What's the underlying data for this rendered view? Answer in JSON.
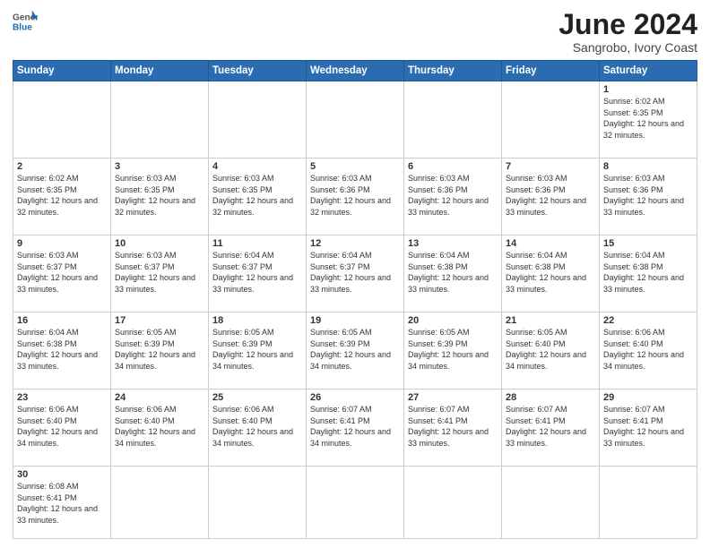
{
  "header": {
    "logo_general": "General",
    "logo_blue": "Blue",
    "month_title": "June 2024",
    "location": "Sangrobo, Ivory Coast"
  },
  "weekdays": [
    "Sunday",
    "Monday",
    "Tuesday",
    "Wednesday",
    "Thursday",
    "Friday",
    "Saturday"
  ],
  "weeks": [
    [
      {
        "day": "",
        "info": ""
      },
      {
        "day": "",
        "info": ""
      },
      {
        "day": "",
        "info": ""
      },
      {
        "day": "",
        "info": ""
      },
      {
        "day": "",
        "info": ""
      },
      {
        "day": "",
        "info": ""
      },
      {
        "day": "1",
        "info": "Sunrise: 6:02 AM\nSunset: 6:35 PM\nDaylight: 12 hours\nand 32 minutes."
      }
    ],
    [
      {
        "day": "2",
        "info": "Sunrise: 6:02 AM\nSunset: 6:35 PM\nDaylight: 12 hours\nand 32 minutes."
      },
      {
        "day": "3",
        "info": "Sunrise: 6:03 AM\nSunset: 6:35 PM\nDaylight: 12 hours\nand 32 minutes."
      },
      {
        "day": "4",
        "info": "Sunrise: 6:03 AM\nSunset: 6:35 PM\nDaylight: 12 hours\nand 32 minutes."
      },
      {
        "day": "5",
        "info": "Sunrise: 6:03 AM\nSunset: 6:36 PM\nDaylight: 12 hours\nand 32 minutes."
      },
      {
        "day": "6",
        "info": "Sunrise: 6:03 AM\nSunset: 6:36 PM\nDaylight: 12 hours\nand 33 minutes."
      },
      {
        "day": "7",
        "info": "Sunrise: 6:03 AM\nSunset: 6:36 PM\nDaylight: 12 hours\nand 33 minutes."
      },
      {
        "day": "8",
        "info": "Sunrise: 6:03 AM\nSunset: 6:36 PM\nDaylight: 12 hours\nand 33 minutes."
      }
    ],
    [
      {
        "day": "9",
        "info": "Sunrise: 6:03 AM\nSunset: 6:37 PM\nDaylight: 12 hours\nand 33 minutes."
      },
      {
        "day": "10",
        "info": "Sunrise: 6:03 AM\nSunset: 6:37 PM\nDaylight: 12 hours\nand 33 minutes."
      },
      {
        "day": "11",
        "info": "Sunrise: 6:04 AM\nSunset: 6:37 PM\nDaylight: 12 hours\nand 33 minutes."
      },
      {
        "day": "12",
        "info": "Sunrise: 6:04 AM\nSunset: 6:37 PM\nDaylight: 12 hours\nand 33 minutes."
      },
      {
        "day": "13",
        "info": "Sunrise: 6:04 AM\nSunset: 6:38 PM\nDaylight: 12 hours\nand 33 minutes."
      },
      {
        "day": "14",
        "info": "Sunrise: 6:04 AM\nSunset: 6:38 PM\nDaylight: 12 hours\nand 33 minutes."
      },
      {
        "day": "15",
        "info": "Sunrise: 6:04 AM\nSunset: 6:38 PM\nDaylight: 12 hours\nand 33 minutes."
      }
    ],
    [
      {
        "day": "16",
        "info": "Sunrise: 6:04 AM\nSunset: 6:38 PM\nDaylight: 12 hours\nand 33 minutes."
      },
      {
        "day": "17",
        "info": "Sunrise: 6:05 AM\nSunset: 6:39 PM\nDaylight: 12 hours\nand 34 minutes."
      },
      {
        "day": "18",
        "info": "Sunrise: 6:05 AM\nSunset: 6:39 PM\nDaylight: 12 hours\nand 34 minutes."
      },
      {
        "day": "19",
        "info": "Sunrise: 6:05 AM\nSunset: 6:39 PM\nDaylight: 12 hours\nand 34 minutes."
      },
      {
        "day": "20",
        "info": "Sunrise: 6:05 AM\nSunset: 6:39 PM\nDaylight: 12 hours\nand 34 minutes."
      },
      {
        "day": "21",
        "info": "Sunrise: 6:05 AM\nSunset: 6:40 PM\nDaylight: 12 hours\nand 34 minutes."
      },
      {
        "day": "22",
        "info": "Sunrise: 6:06 AM\nSunset: 6:40 PM\nDaylight: 12 hours\nand 34 minutes."
      }
    ],
    [
      {
        "day": "23",
        "info": "Sunrise: 6:06 AM\nSunset: 6:40 PM\nDaylight: 12 hours\nand 34 minutes."
      },
      {
        "day": "24",
        "info": "Sunrise: 6:06 AM\nSunset: 6:40 PM\nDaylight: 12 hours\nand 34 minutes."
      },
      {
        "day": "25",
        "info": "Sunrise: 6:06 AM\nSunset: 6:40 PM\nDaylight: 12 hours\nand 34 minutes."
      },
      {
        "day": "26",
        "info": "Sunrise: 6:07 AM\nSunset: 6:41 PM\nDaylight: 12 hours\nand 34 minutes."
      },
      {
        "day": "27",
        "info": "Sunrise: 6:07 AM\nSunset: 6:41 PM\nDaylight: 12 hours\nand 33 minutes."
      },
      {
        "day": "28",
        "info": "Sunrise: 6:07 AM\nSunset: 6:41 PM\nDaylight: 12 hours\nand 33 minutes."
      },
      {
        "day": "29",
        "info": "Sunrise: 6:07 AM\nSunset: 6:41 PM\nDaylight: 12 hours\nand 33 minutes."
      }
    ],
    [
      {
        "day": "30",
        "info": "Sunrise: 6:08 AM\nSunset: 6:41 PM\nDaylight: 12 hours\nand 33 minutes."
      },
      {
        "day": "",
        "info": ""
      },
      {
        "day": "",
        "info": ""
      },
      {
        "day": "",
        "info": ""
      },
      {
        "day": "",
        "info": ""
      },
      {
        "day": "",
        "info": ""
      },
      {
        "day": "",
        "info": ""
      }
    ]
  ]
}
